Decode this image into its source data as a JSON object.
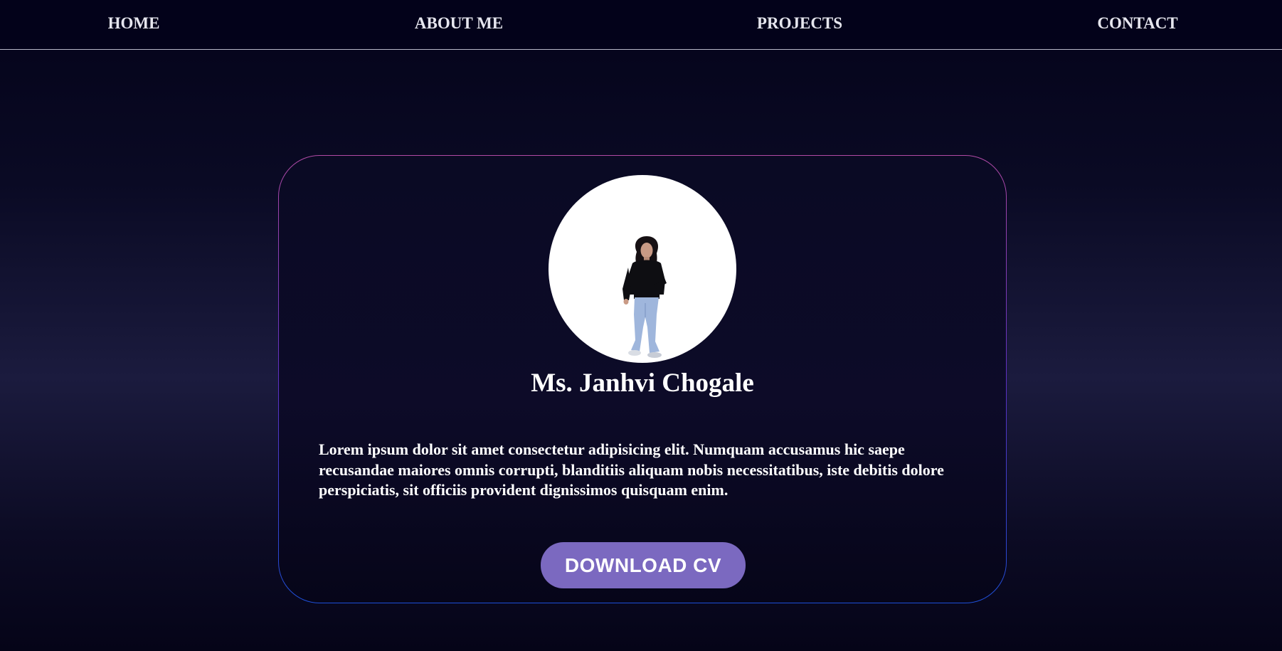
{
  "nav": {
    "items": [
      {
        "label": "HOME"
      },
      {
        "label": "ABOUT ME"
      },
      {
        "label": "PROJECTS"
      },
      {
        "label": "CONTACT"
      }
    ]
  },
  "profile": {
    "name": "Ms. Janhvi Chogale",
    "bio": "Lorem ipsum dolor sit amet consectetur adipisicing elit. Numquam accusamus hic saepe recusandae maiores omnis corrupti, blanditiis aliquam nobis necessitatibus, iste debitis dolore perspiciatis, sit officiis provident dignissimos quisquam enim.",
    "download_label": "DOWNLOAD CV"
  },
  "colors": {
    "background": "#0a0a24",
    "navbar": "#03021a",
    "button": "#7b69c0",
    "card_border_top": "#b14aa5",
    "card_border_bottom": "#1e4fd8",
    "text": "#ffffff"
  }
}
